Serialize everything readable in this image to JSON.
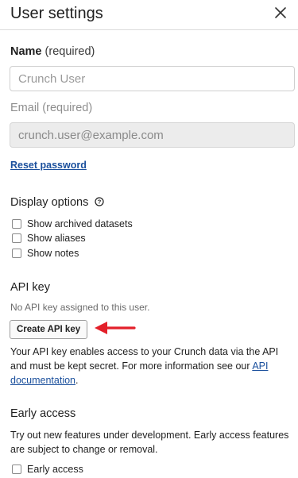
{
  "header": {
    "title": "User settings",
    "close_icon": "close-icon"
  },
  "name": {
    "label": "Name",
    "required": "(required)",
    "placeholder": "Crunch User"
  },
  "email": {
    "label": "Email",
    "required": "(required)",
    "value": "crunch.user@example.com"
  },
  "reset_password": "Reset password",
  "display_options": {
    "title": "Display options",
    "info_icon": "info-circle-icon",
    "items": [
      {
        "label": "Show archived datasets",
        "checked": false
      },
      {
        "label": "Show aliases",
        "checked": false
      },
      {
        "label": "Show notes",
        "checked": false
      }
    ]
  },
  "api_key": {
    "title": "API key",
    "status": "No API key assigned to this user.",
    "button": "Create API key",
    "description_pre": "Your API key enables access to your Crunch data via the API and must be kept secret. For more information see our ",
    "doc_link": "API documentation",
    "description_post": ".",
    "arrow_color": "#e3202a"
  },
  "early_access": {
    "title": "Early access",
    "description": "Try out new features under development. Early access features are subject to change or removal.",
    "checkbox_label": "Early access",
    "checked": false
  }
}
